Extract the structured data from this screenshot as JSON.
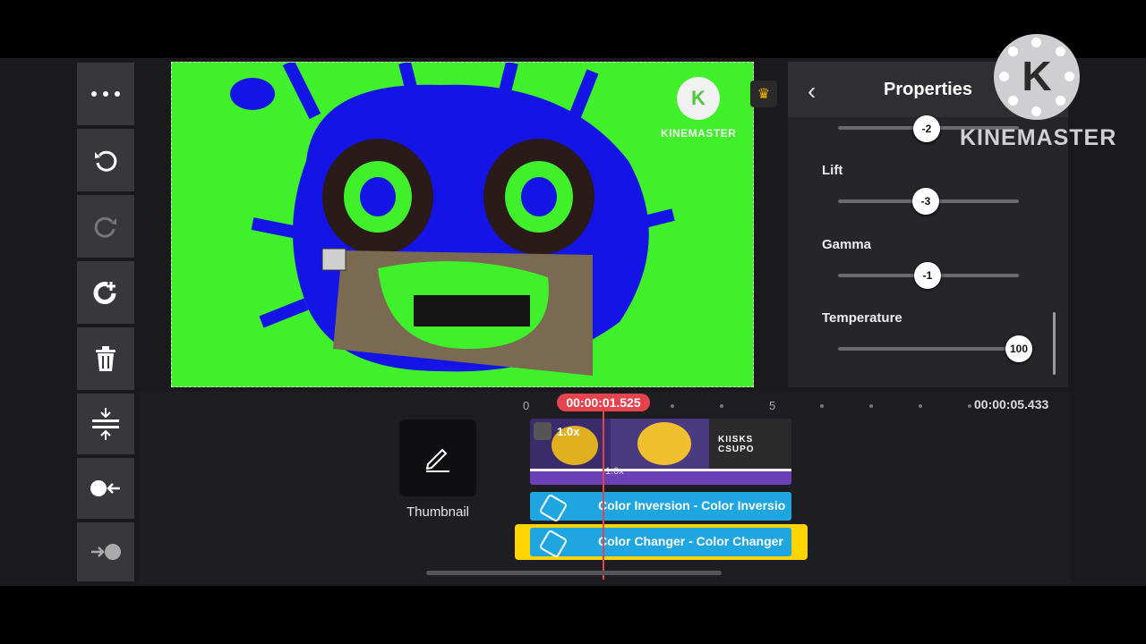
{
  "toolbar": {
    "items": [
      "more-icon",
      "undo-icon",
      "redo-icon",
      "rotate-add-icon",
      "delete-icon",
      "split-icon",
      "trim-left-icon",
      "trim-right-icon"
    ]
  },
  "preview": {
    "watermark": "KINEMASTER",
    "watermark_logo_letter": "K"
  },
  "properties": {
    "title": "Properties",
    "partial_value": "-2",
    "sliders": [
      {
        "label": "Lift",
        "value": "-3",
        "fraction": 0.48
      },
      {
        "label": "Gamma",
        "value": "-1",
        "fraction": 0.49
      },
      {
        "label": "Temperature",
        "value": "100",
        "fraction": 1.0
      }
    ]
  },
  "brand_watermark": {
    "letter": "K",
    "text": "KINEMASTER"
  },
  "timeline": {
    "current_time": "00:00:01.525",
    "end_time": "00:00:05.433",
    "ruler": [
      "0",
      "5"
    ],
    "thumbnail_label": "Thumbnail",
    "clip_speed": "1.0x",
    "clip_speed_2": "1.0x",
    "clip_text": "KIISKS CSUPO",
    "fx_layers": [
      {
        "label": "Color Inversion - Color Inversio"
      },
      {
        "label": "Color Changer - Color Changer"
      }
    ]
  },
  "colors": {
    "accent": "#e5434e",
    "fx_blue": "#1fa6e0",
    "selected_yellow": "#ffd400",
    "preview_green": "#3ff02a",
    "preview_blue": "#1414e6"
  }
}
